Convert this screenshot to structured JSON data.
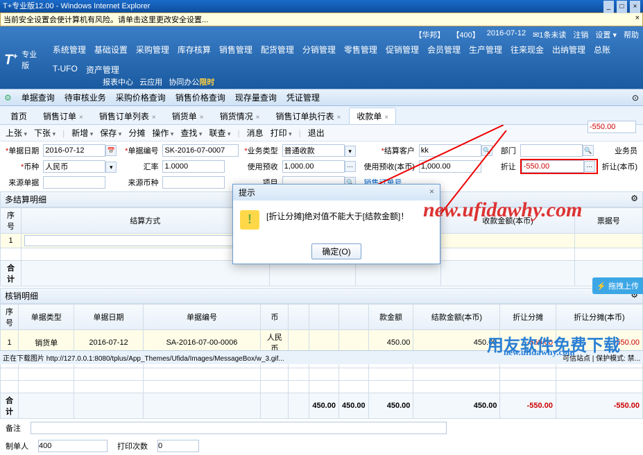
{
  "window": {
    "title": "T+专业版12.00 - Windows Internet Explorer"
  },
  "security_warn": "当前安全设置会使计算机有风险。请单击这里更改安全设置...",
  "header": {
    "links": [
      "【华邦】",
      "【400】",
      "2016-07-12",
      "✉1条未读",
      "注销",
      "设置 ▾",
      "帮助"
    ],
    "logo": "T",
    "logo_plus": "+",
    "edition": "专业版",
    "nav": [
      "系统管理",
      "基础设置",
      "采购管理",
      "库存核算",
      "销售管理",
      "配货管理",
      "分销管理",
      "零售管理",
      "促销管理",
      "会员管理",
      "生产管理",
      "往来现金",
      "出纳管理",
      "总账",
      "T-UFO",
      "资产管理"
    ],
    "sub": [
      "报表中心",
      "云应用",
      "协同办公"
    ],
    "sub_hot": "限时"
  },
  "toolbar2": [
    "单据查询",
    "待审核业务",
    "采购价格查询",
    "销售价格查询",
    "现存量查询",
    "凭证管理"
  ],
  "tabs": [
    "首页",
    "销售订单",
    "销售订单列表",
    "销货单",
    "销货情况",
    "销售订单执行表",
    "收款单"
  ],
  "active_tab": 6,
  "actions": [
    "上张",
    "下张",
    "新增",
    "保存",
    "分摊",
    "操作",
    "查找",
    "联查",
    "消息",
    "打印",
    "退出"
  ],
  "form": {
    "date_lbl": "单据日期",
    "date": "2016-07-12",
    "code_lbl": "单据编号",
    "code": "SK-2016-07-0007",
    "type_lbl": "业务类型",
    "type": "普通收款",
    "cust_lbl": "结算客户",
    "cust": "kk",
    "dept_lbl": "部门",
    "dept": "",
    "clerk_lbl": "业务员",
    "clerk": "",
    "curr_lbl": "币种",
    "curr": "人民币",
    "rate_lbl": "汇率",
    "rate": "1.0000",
    "prepay_lbl": "使用预收",
    "prepay": "1,000.00",
    "prepay_local_lbl": "使用预收(本币)",
    "prepay_local": "1,000.00",
    "discount_lbl": "折让",
    "discount": "-550.00",
    "discount_local_lbl": "折让(本币)",
    "discount_local": "-550.00",
    "src_lbl": "来源单据",
    "src": "",
    "src_curr_lbl": "来源币种",
    "src_curr": "",
    "proj_lbl": "项目",
    "proj": "",
    "order_link": "销售订单号"
  },
  "grid1": {
    "title": "多结算明细",
    "cols": [
      "序号",
      "结算方式",
      "账号名称",
      "收款金额",
      "收款金额(本币)",
      "票据号"
    ],
    "rows": [
      [
        "1",
        "",
        "",
        "",
        "",
        ""
      ]
    ],
    "total": "合计"
  },
  "grid2": {
    "title": "核销明细",
    "cols": [
      "序号",
      "单据类型",
      "单据日期",
      "单据编号",
      "币",
      "",
      "",
      "",
      "款金额",
      "结款金额(本币)",
      "折让分摊",
      "折让分摊(本币)"
    ],
    "rows": [
      [
        "1",
        "销货单",
        "2016-07-12",
        "SA-2016-07-00-0006",
        "人民币",
        "",
        "",
        "",
        "450.00",
        "450.00",
        "-550.00",
        "-550.00"
      ]
    ],
    "total_row": [
      "合计",
      "",
      "",
      "",
      "",
      "",
      "450.00",
      "450.00",
      "450.00",
      "450.00",
      "-550.00",
      "-550.00"
    ]
  },
  "footer": {
    "remark_lbl": "备注",
    "remark": "",
    "maker_lbl": "制单人",
    "maker": "400",
    "printcnt_lbl": "打印次数",
    "printcnt": "0"
  },
  "modal": {
    "title": "提示",
    "msg": "[折让分摊]绝对值不能大于[结款金额]！",
    "ok": "确定(O)"
  },
  "status": {
    "left": "正在下载图片 http://127.0.0.1:8080/tplus/App_Themes/Ufida/Images/MessageBox/w_3.gif...",
    "right": "可信站点 | 保护模式: 禁..."
  },
  "floatbtn": "⚡ 拖拽上传",
  "watermark1": "new.ufidawhy.com",
  "watermark2": "用友软件免费下载",
  "watermark3": "new.ufidawhy.com"
}
